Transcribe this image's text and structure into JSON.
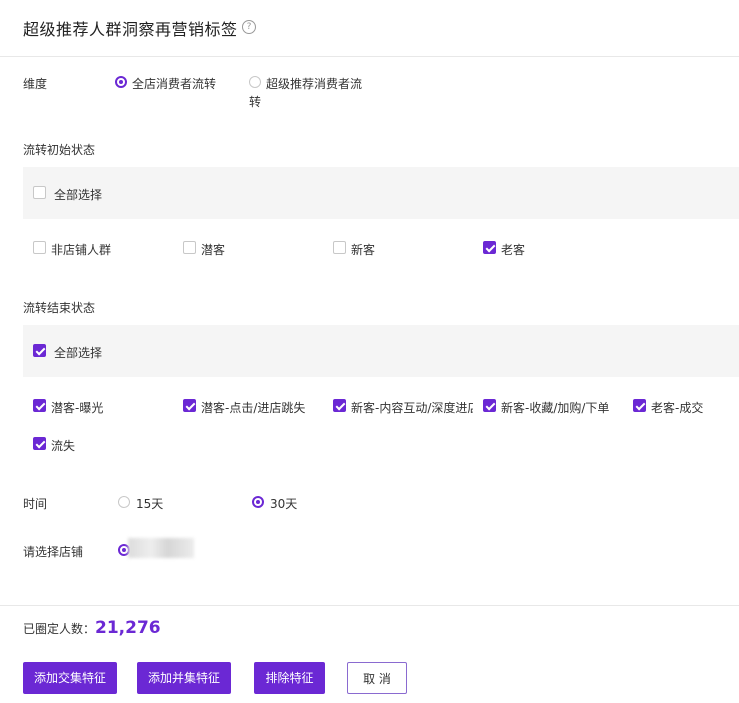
{
  "header": {
    "title": "超级推荐人群洞察再营销标签",
    "help_icon": "?"
  },
  "dimension": {
    "label": "维度",
    "options": [
      {
        "label": "全店消费者流转",
        "selected": true
      },
      {
        "label": "超级推荐消费者流",
        "label_line2": "转",
        "selected": false
      }
    ]
  },
  "start_state": {
    "label": "流转初始状态",
    "select_all": {
      "label": "全部选择",
      "checked": false
    },
    "items": [
      {
        "label": "非店铺人群",
        "checked": false
      },
      {
        "label": "潜客",
        "checked": false
      },
      {
        "label": "新客",
        "checked": false
      },
      {
        "label": "老客",
        "checked": true
      }
    ]
  },
  "end_state": {
    "label": "流转结束状态",
    "select_all": {
      "label": "全部选择",
      "checked": true
    },
    "items": [
      {
        "label": "潜客-曝光",
        "checked": true
      },
      {
        "label": "潜客-点击/进店跳失",
        "checked": true
      },
      {
        "label": "新客-内容互动/深度进店",
        "checked": true
      },
      {
        "label": "新客-收藏/加购/下单",
        "checked": true
      },
      {
        "label": "老客-成交",
        "checked": true
      },
      {
        "label": "流失",
        "checked": true
      }
    ]
  },
  "time": {
    "label": "时间",
    "options": [
      {
        "label": "15天",
        "selected": false
      },
      {
        "label": "30天",
        "selected": true
      }
    ]
  },
  "store": {
    "label": "请选择店铺"
  },
  "footer": {
    "count_label": "已圈定人数：",
    "count_value": "21,276",
    "buttons": {
      "intersect": "添加交集特征",
      "union": "添加并集特征",
      "exclude": "排除特征",
      "cancel": "取 消"
    }
  },
  "colors": {
    "accent": "#6b28d4"
  }
}
